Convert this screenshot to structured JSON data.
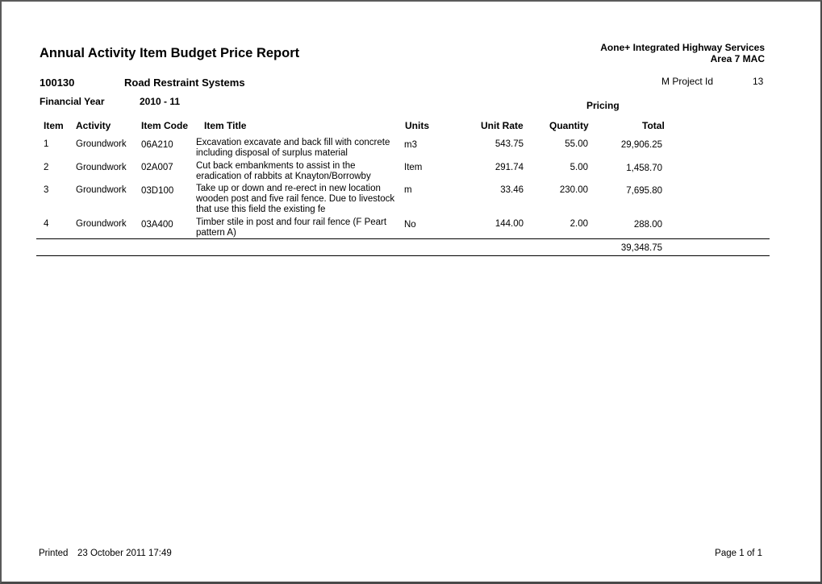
{
  "report": {
    "title": "Annual Activity Item Budget Price Report",
    "company_line1": "Aone+ Integrated Highway Services",
    "company_line2": "Area 7 MAC",
    "project_code": "100130",
    "project_name": "Road Restraint Systems",
    "m_project_id_label": "M Project Id",
    "m_project_id_value": "13",
    "financial_year_label": "Financial Year",
    "financial_year_value": "2010 - 11",
    "pricing_label": "Pricing"
  },
  "table": {
    "headers": {
      "item": "Item",
      "activity": "Activity",
      "item_code": "Item Code",
      "item_title": "Item Title",
      "units": "Units",
      "unit_rate": "Unit Rate",
      "quantity": "Quantity",
      "total": "Total"
    },
    "rows": [
      {
        "item": "1",
        "activity": "Groundwork",
        "item_code": "06A210",
        "item_title": "Excavation excavate and back fill with concrete including disposal of surplus material",
        "units": "m3",
        "unit_rate": "543.75",
        "quantity": "55.00",
        "total": "29,906.25"
      },
      {
        "item": "2",
        "activity": "Groundwork",
        "item_code": "02A007",
        "item_title": "Cut back embankments to assist in the eradication of rabbits at Knayton/Borrowby",
        "units": "Item",
        "unit_rate": "291.74",
        "quantity": "5.00",
        "total": "1,458.70"
      },
      {
        "item": "3",
        "activity": "Groundwork",
        "item_code": "03D100",
        "item_title": "Take up or down and re-erect in new location wooden post and five rail fence. Due to livestock that use this field the existing fe",
        "units": "m",
        "unit_rate": "33.46",
        "quantity": "230.00",
        "total": "7,695.80"
      },
      {
        "item": "4",
        "activity": "Groundwork",
        "item_code": "03A400",
        "item_title": "Timber stile in post and four rail fence (F Peart pattern A)",
        "units": "No",
        "unit_rate": "144.00",
        "quantity": "2.00",
        "total": "288.00"
      }
    ],
    "grand_total": "39,348.75"
  },
  "footer": {
    "printed_label": "Printed",
    "printed_value": "23 October 2011 17:49",
    "page": "Page 1 of 1"
  }
}
